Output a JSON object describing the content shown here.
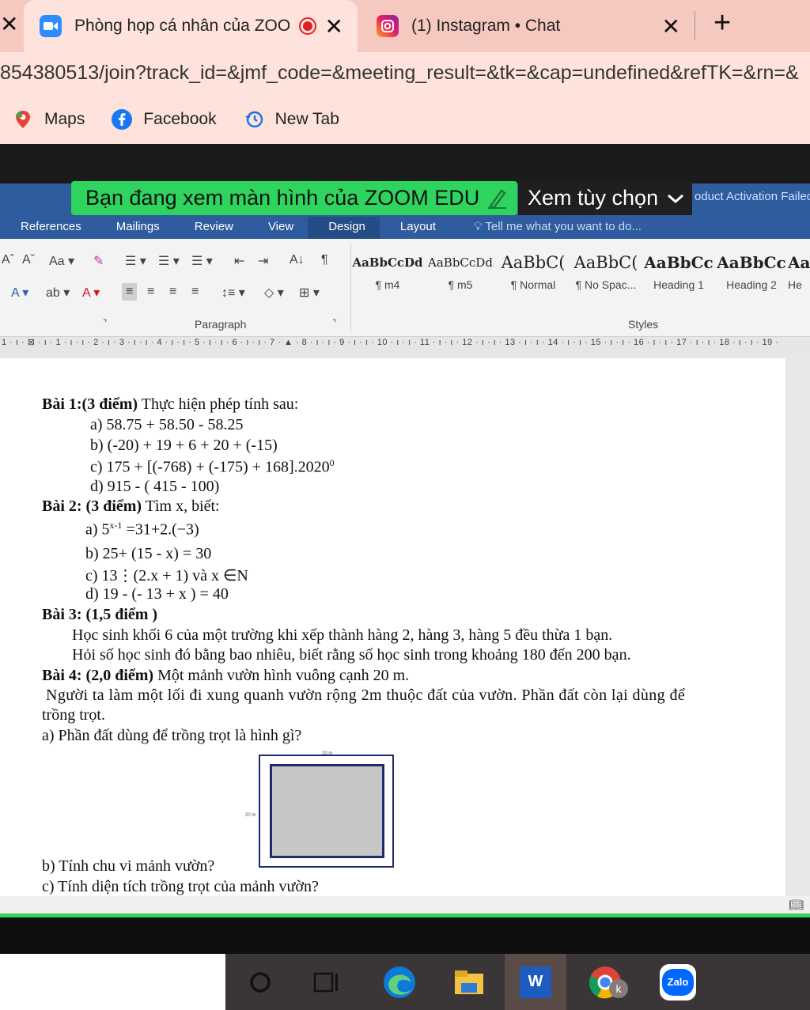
{
  "browser": {
    "tabs": [
      {
        "title": "Phòng họp cá nhân của ZOO",
        "close": "✕"
      },
      {
        "title": "(1) Instagram • Chat",
        "close": "✕"
      }
    ],
    "new_tab": "+",
    "left_close": "✕",
    "url": "854380513/join?track_id=&jmf_code=&meeting_result=&tk=&cap=undefined&refTK=&rn=&",
    "bookmarks": [
      "Maps",
      "Facebook",
      "New Tab"
    ]
  },
  "zoom": {
    "share_banner": "Bạn đang xem màn hình của ZOOM EDU",
    "view_options": "Xem tùy chọn"
  },
  "word": {
    "activation": "oduct Activation Failed",
    "tabs": [
      "References",
      "Mailings",
      "Review",
      "View",
      "Design",
      "Layout"
    ],
    "tell_me": "Tell me what you want to do...",
    "group_paragraph": "Paragraph",
    "group_styles": "Styles",
    "styles": [
      {
        "sample": "AaBbCcDd",
        "name": "¶ m4"
      },
      {
        "sample": "AaBbCcDd",
        "name": "¶ m5"
      },
      {
        "sample": "AaBbC(",
        "name": "¶ Normal"
      },
      {
        "sample": "AaBbC(",
        "name": "¶ No Spac..."
      },
      {
        "sample": "AaBbCc",
        "name": "Heading 1"
      },
      {
        "sample": "AaBbCc",
        "name": "Heading 2"
      },
      {
        "sample": "Aa",
        "name": "He"
      }
    ],
    "ruler": "1 · ı · ⊠ · ı · 1 · ı · ı · 2 · ı · 3 · ı · ı · 4 · ı · ı · 5 · ı · ı · 6 · ı · ı · 7 · ▲ · 8 · ı · ı · 9 · ı · ı · 10 · ı · ı · 11 · ı · ı · 12 · ı · ı · 13 · ı · ı · 14 · ı · ı · 15 · ı · ı · 16 · ı · ı · 17 · ı · ı · 18 · ı · ı · 19 ·"
  },
  "document": {
    "b1_head": "Bài 1:(3 điểm)",
    "b1_text": " Thực hiện phép tính sau:",
    "b1_a": "a) 58.75 + 58.50 - 58.25",
    "b1_b": "b) (-20) + 19 + 6 + 20 + (-15)",
    "b1_c": "c) 175 + [(-768) + (-175) + 168].2020",
    "b1_c_sup": "0",
    "b1_d": "d) 915 - ( 415 - 100)",
    "b2_head": "Bài 2: (3 điểm)",
    "b2_text": " Tìm x, biết:",
    "b2_a_pre": "a) 5",
    "b2_a_sup": "x-1",
    "b2_a_post": " =31+2.(−3)",
    "b2_b": "b) 25+ (15 - x) = 30",
    "b2_c": "c) 13⋮(2.x + 1) và x ∈N",
    "b2_d": "d) 19 - (- 13 + x ) = 40",
    "b3_head": "Bài 3: (1,5 điểm )",
    "b3_l1": "Học sinh khối 6 của một trường khi xếp thành hàng 2, hàng 3, hàng 5 đều thừa 1 bạn.",
    "b3_l2": "Hỏi số học sinh đó bằng bao nhiêu, biết rằng số học sinh trong khoảng 180 đến 200 bạn.",
    "b4_head": "Bài 4: (2,0 điểm)",
    "b4_text": " Một mảnh vườn hình vuông cạnh 20 m.",
    "b4_l1": "Người ta làm một lối đi xung quanh vườn rộng 2m thuộc đất của vườn. Phần đất còn lại dùng để",
    "b4_l2": "trồng trọt.",
    "b4_a": "a) Phần đất dùng để trồng trọt là hình gì?",
    "b4_b": "b) Tính chu vi mảnh vườn?",
    "b4_c": "c) Tính diện tích trồng trọt của mảnh vườn?",
    "fig_top": "20 m",
    "fig_left": "20 m"
  },
  "taskbar": {
    "word_label": "W",
    "zalo_label": "Zalo",
    "avatar_label": "k"
  }
}
